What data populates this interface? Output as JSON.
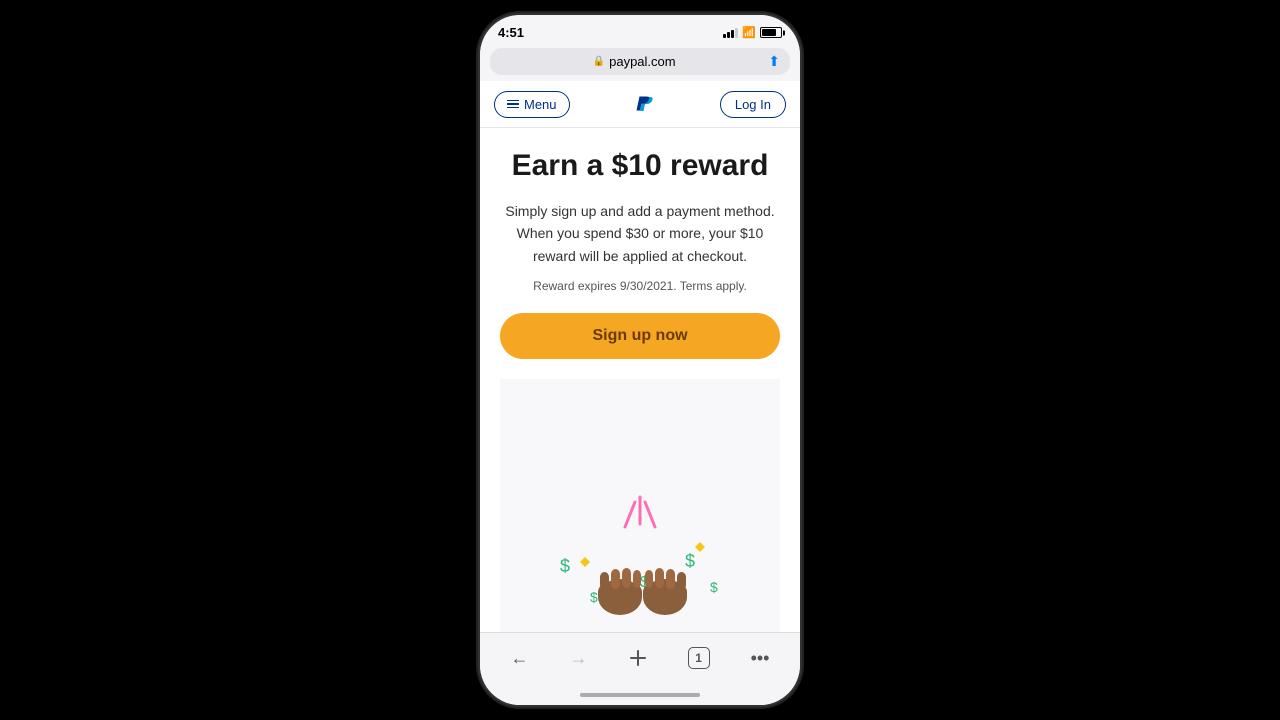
{
  "status_bar": {
    "time": "4:51",
    "signal_indicator": "▲▲▲",
    "wifi": "wifi",
    "battery": "battery"
  },
  "browser": {
    "url": "paypal.com",
    "lock_icon": "🔒",
    "share_icon": "⬆"
  },
  "nav": {
    "menu_label": "Menu",
    "login_label": "Log In"
  },
  "content": {
    "headline": "Earn a $10 reward",
    "description": "Simply sign up and add a payment method. When you spend $30 or more, your $10 reward will be applied at checkout.",
    "expiry": "Reward expires 9/30/2021. Terms apply.",
    "signup_button": "Sign up now"
  },
  "toolbar": {
    "back": "←",
    "forward": "→",
    "add": "+",
    "tabs": "1",
    "more": "•••"
  },
  "colors": {
    "paypal_blue": "#003087",
    "button_gold": "#f5a623",
    "button_text": "#6b3a00"
  }
}
